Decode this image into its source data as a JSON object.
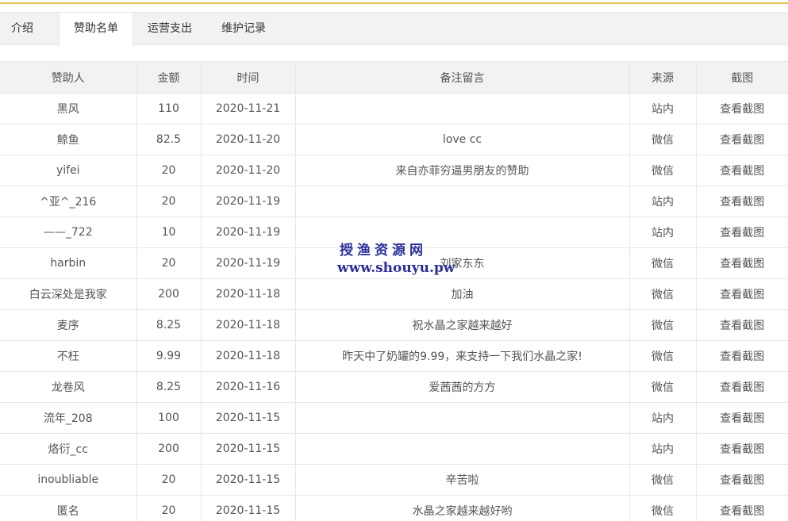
{
  "tabs": [
    {
      "label": "介绍"
    },
    {
      "label": "赞助名单"
    },
    {
      "label": "运营支出"
    },
    {
      "label": "维护记录"
    }
  ],
  "active_tab": "赞助名单",
  "table": {
    "headers": [
      "赞助人",
      "金额",
      "时间",
      "备注留言",
      "来源",
      "截图"
    ],
    "rows": [
      {
        "name": "黑风",
        "amount": "110",
        "date": "2020-11-21",
        "note": "",
        "source": "站内",
        "shot": "查看截图"
      },
      {
        "name": "鲸鱼",
        "amount": "82.5",
        "date": "2020-11-20",
        "note": "love cc",
        "source": "微信",
        "shot": "查看截图"
      },
      {
        "name": "yifei",
        "amount": "20",
        "date": "2020-11-20",
        "note": "来自亦菲穷逼男朋友的赞助",
        "source": "微信",
        "shot": "查看截图"
      },
      {
        "name": "^亚^_216",
        "amount": "20",
        "date": "2020-11-19",
        "note": "",
        "source": "站内",
        "shot": "查看截图"
      },
      {
        "name": "——_722",
        "amount": "10",
        "date": "2020-11-19",
        "note": "",
        "source": "站内",
        "shot": "查看截图"
      },
      {
        "name": "harbin",
        "amount": "20",
        "date": "2020-11-19",
        "note": "刘家东东",
        "source": "微信",
        "shot": "查看截图"
      },
      {
        "name": "白云深处是我家",
        "amount": "200",
        "date": "2020-11-18",
        "note": "加油",
        "source": "微信",
        "shot": "查看截图"
      },
      {
        "name": "麦序",
        "amount": "8.25",
        "date": "2020-11-18",
        "note": "祝水晶之家越来越好",
        "source": "微信",
        "shot": "查看截图"
      },
      {
        "name": "不枉",
        "amount": "9.99",
        "date": "2020-11-18",
        "note": "昨天中了奶罐的9.99，来支持一下我们水晶之家!",
        "source": "微信",
        "shot": "查看截图"
      },
      {
        "name": "龙卷风",
        "amount": "8.25",
        "date": "2020-11-16",
        "note": "爱茜茜的方方",
        "source": "微信",
        "shot": "查看截图"
      },
      {
        "name": "流年_208",
        "amount": "100",
        "date": "2020-11-15",
        "note": "",
        "source": "站内",
        "shot": "查看截图"
      },
      {
        "name": "烙衍_cc",
        "amount": "200",
        "date": "2020-11-15",
        "note": "",
        "source": "站内",
        "shot": "查看截图"
      },
      {
        "name": "inoubliable",
        "amount": "20",
        "date": "2020-11-15",
        "note": "辛苦啦",
        "source": "微信",
        "shot": "查看截图"
      },
      {
        "name": "匿名",
        "amount": "20",
        "date": "2020-11-15",
        "note": "水晶之家越来越好哟",
        "source": "微信",
        "shot": "查看截图"
      }
    ]
  },
  "watermark": {
    "line1": "授渔资源网",
    "line2": "www.shouyu.pw"
  },
  "colors": {
    "accent_line": "#e6c24a",
    "watermark": "#2b2f9a",
    "link_muted": "#aaaaaa"
  }
}
